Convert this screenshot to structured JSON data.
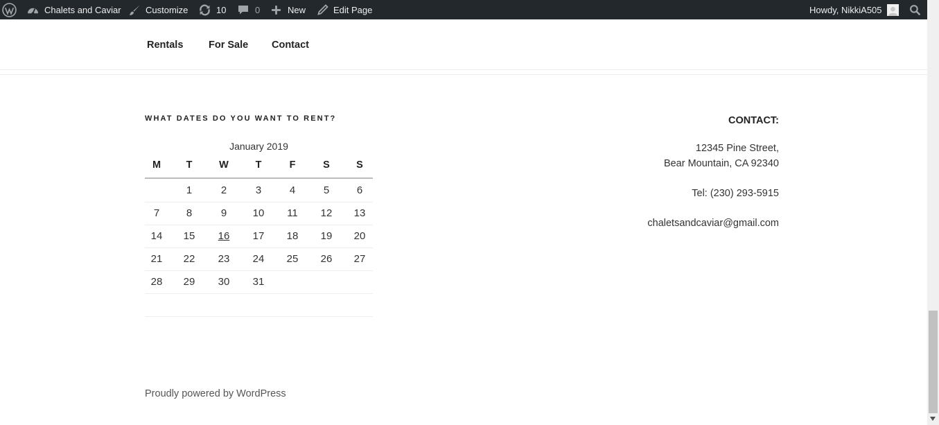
{
  "adminbar": {
    "site_name": "Chalets and Caviar",
    "customize": "Customize",
    "updates_count": "10",
    "comments_count": "0",
    "new": "New",
    "edit_page": "Edit Page",
    "howdy": "Howdy, NikkiA505"
  },
  "nav": {
    "items": [
      {
        "label": "Rentals"
      },
      {
        "label": "For Sale"
      },
      {
        "label": "Contact"
      }
    ]
  },
  "calendar": {
    "widget_title": "What dates do you want to rent?",
    "caption": "January 2019",
    "weekdays": [
      "M",
      "T",
      "W",
      "T",
      "F",
      "S",
      "S"
    ],
    "weeks": [
      [
        "",
        "1",
        "2",
        "3",
        "4",
        "5",
        "6"
      ],
      [
        "7",
        "8",
        "9",
        "10",
        "11",
        "12",
        "13"
      ],
      [
        "14",
        "15",
        "16",
        "17",
        "18",
        "19",
        "20"
      ],
      [
        "21",
        "22",
        "23",
        "24",
        "25",
        "26",
        "27"
      ],
      [
        "28",
        "29",
        "30",
        "31",
        "",
        "",
        ""
      ]
    ],
    "today": "16"
  },
  "contact": {
    "title": "CONTACT:",
    "address_line1": "12345 Pine Street,",
    "address_line2": "Bear Mountain, CA 92340",
    "tel": "Tel: (230) 293-5915",
    "email": "chaletsandcaviar@gmail.com"
  },
  "footer": {
    "powered_by": "Proudly powered by WordPress"
  }
}
